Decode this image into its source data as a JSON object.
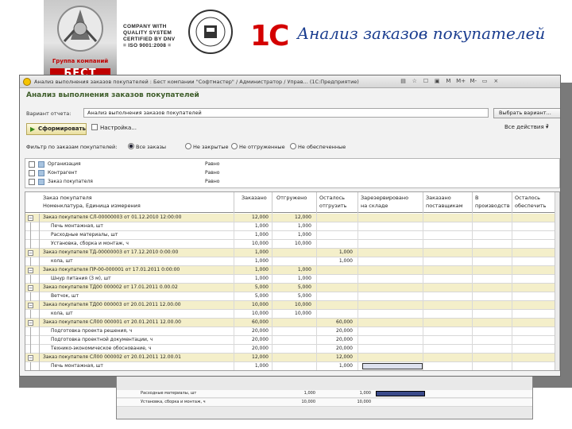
{
  "slide": {
    "title": "Анализ заказов покупателей",
    "group_caption": "Группа компаний",
    "group_brand": "БЕСТ",
    "cert_lines": [
      "COMPANY WITH",
      "QUALITY SYSTEM",
      "CERTIFIED BY DNV",
      "= ISO 9001:2008 ="
    ],
    "onec_logo": "1С"
  },
  "window": {
    "title": "Анализ выполнения заказов покупателей : Бест компании \"Софтмастер\" / Администратор / Управ... (1С:Предприятие)",
    "toolbar_glyphs": [
      "▤",
      "☆",
      "☐",
      "▣",
      "M",
      "M+",
      "M-",
      "▭",
      "×"
    ]
  },
  "form": {
    "title": "Анализ выполнения заказов покупателей",
    "variant_label": "Вариант отчета:",
    "variant_value": "Анализ выполнения заказов покупателей",
    "variant_button": "Выбрать вариант...",
    "generate_button": "Сформировать",
    "settings_button": "Настройка...",
    "actions_button": "Все действия ▾",
    "tail_text": "?",
    "filter_label": "Фильтр по заказам покупателей:",
    "filter_options": [
      "Все заказы",
      "Не закрытые",
      "Не отгруженные",
      "Не обеспеченные"
    ],
    "filter_selected_index": 0
  },
  "params": [
    {
      "name": "Организация",
      "condition": "Равно"
    },
    {
      "name": "Контрагент",
      "condition": "Равно"
    },
    {
      "name": "Заказ покупателя",
      "condition": "Равно"
    }
  ],
  "report": {
    "header_line1": [
      "Заказ покупателя",
      "Заказано",
      "Отгружено",
      "Осталось",
      "Зарезервировано",
      "Заказано",
      "В",
      "Осталось"
    ],
    "header_line2": [
      "Номенклатура, Единица измерения",
      "",
      "",
      "отгрузить",
      "на складе",
      "поставщикам",
      "производстве",
      "обеспечить"
    ],
    "rows": [
      {
        "type": "order",
        "name": "Заказ покупателя СЛ-00000003 от 01.12.2010 12:00:00",
        "ordered": "12,000",
        "shipped": "12,000",
        "left": "",
        "reserved": ""
      },
      {
        "type": "item",
        "name": "Печь монтажная, шт",
        "ordered": "1,000",
        "shipped": "1,000",
        "left": "",
        "reserved": ""
      },
      {
        "type": "item",
        "name": "Расходные материалы, шт",
        "ordered": "1,000",
        "shipped": "1,000",
        "left": "",
        "reserved": ""
      },
      {
        "type": "item",
        "name": "Установка, сборка и монтаж, ч",
        "ordered": "10,000",
        "shipped": "10,000",
        "left": "",
        "reserved": ""
      },
      {
        "type": "order",
        "name": "Заказ покупателя ТД-00000003 от 17.12.2010 0:00:00",
        "ordered": "1,000",
        "shipped": "",
        "left": "1,000",
        "reserved": ""
      },
      {
        "type": "item",
        "name": "кола, шт",
        "ordered": "1,000",
        "shipped": "",
        "left": "1,000",
        "reserved": ""
      },
      {
        "type": "order",
        "name": "Заказ покупателя ПР-00-000001 от 17.01.2011 0:00:00",
        "ordered": "1,000",
        "shipped": "1,000",
        "left": "",
        "reserved": ""
      },
      {
        "type": "item",
        "name": "Шнур питания (3 м), шт",
        "ordered": "1,000",
        "shipped": "1,000",
        "left": "",
        "reserved": ""
      },
      {
        "type": "order",
        "name": "Заказ покупателя ТД00 000002 от 17.01.2011 0.00.02",
        "ordered": "5,000",
        "shipped": "5,000",
        "left": "",
        "reserved": ""
      },
      {
        "type": "item",
        "name": "Ветчок, шт",
        "ordered": "5,000",
        "shipped": "5,000",
        "left": "",
        "reserved": ""
      },
      {
        "type": "order",
        "name": "Заказ покупателя ТД00 000003 от 20.01.2011 12.00.00",
        "ordered": "10,000",
        "shipped": "10,000",
        "left": "",
        "reserved": ""
      },
      {
        "type": "item",
        "name": "кола, шт",
        "ordered": "10,000",
        "shipped": "10,000",
        "left": "",
        "reserved": ""
      },
      {
        "type": "order",
        "name": "Заказ покупателя СЛ00 000001 от 20.01.2011 12.00.00",
        "ordered": "60,000",
        "shipped": "",
        "left": "60,000",
        "reserved": ""
      },
      {
        "type": "item",
        "name": "Подготовка проекта решения, ч",
        "ordered": "20,000",
        "shipped": "",
        "left": "20,000",
        "reserved": ""
      },
      {
        "type": "item",
        "name": "Подготовка проектной документации, ч",
        "ordered": "20,000",
        "shipped": "",
        "left": "20,000",
        "reserved": ""
      },
      {
        "type": "item",
        "name": "Технико-экономическое обоснование, ч",
        "ordered": "20,000",
        "shipped": "",
        "left": "20,000",
        "reserved": ""
      },
      {
        "type": "order",
        "name": "Заказ покупателя СЛ00 000002 от 20.01.2011 12.00.01",
        "ordered": "12,000",
        "shipped": "",
        "left": "12,000",
        "reserved": ""
      },
      {
        "type": "item",
        "name": "Печь монтажная, шт",
        "ordered": "1,000",
        "shipped": "",
        "left": "1,000",
        "reserved": ""
      },
      {
        "type": "item",
        "name": "Расходные материалы, шт",
        "ordered": "1,000",
        "shipped": "",
        "left": "1,000",
        "reserved": ""
      },
      {
        "type": "item",
        "name": "Установка, сборка и монтаж, ч",
        "ordered": "10,000",
        "shipped": "",
        "left": "10,000",
        "reserved": ""
      }
    ]
  },
  "bottom_panel": {
    "rows": [
      {
        "name": "Расходные материалы, шт",
        "v1": "1,000",
        "v2": "1,000"
      },
      {
        "name": "Установка, сборка и монтаж, ч",
        "v1": "10,000",
        "v2": "10,000"
      }
    ]
  },
  "colors": {
    "accent_red": "#d40000",
    "title_blue": "#1a3d8f",
    "form_title_green": "#3e5d2a",
    "order_row": "#f4efca"
  }
}
